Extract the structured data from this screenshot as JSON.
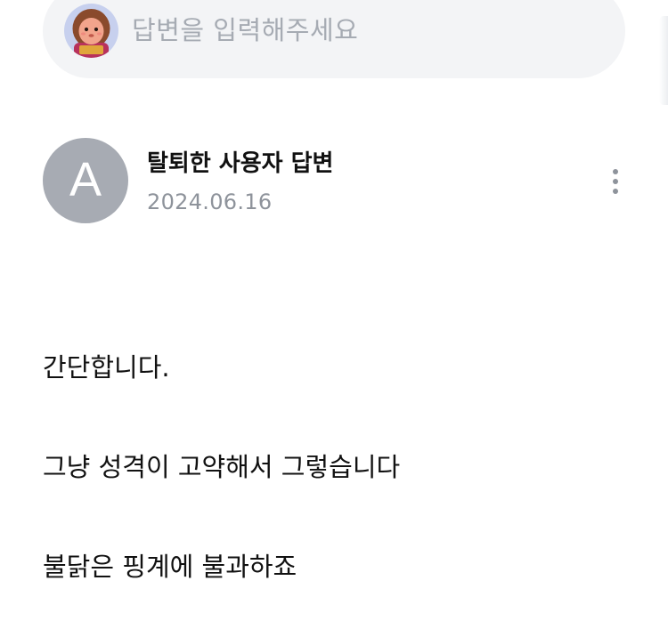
{
  "answer_input": {
    "placeholder": "답변을 입력해주세요",
    "avatar_icon": "character-avatar-icon"
  },
  "answer": {
    "author_avatar_letter": "A",
    "author_name": "탈퇴한 사용자 답변",
    "date": "2024.06.16",
    "more_icon": "more-vertical-icon",
    "body": [
      "간단합니다.",
      "그냥 성격이 고약해서 그렇습니다",
      "불닭은 핑계에 불과하죠"
    ]
  },
  "colors": {
    "input_background": "#f3f4f6",
    "placeholder_text": "#a6abb3",
    "author_avatar_background": "#a7abb3",
    "date_text": "#8e939b",
    "body_text": "#111111"
  }
}
